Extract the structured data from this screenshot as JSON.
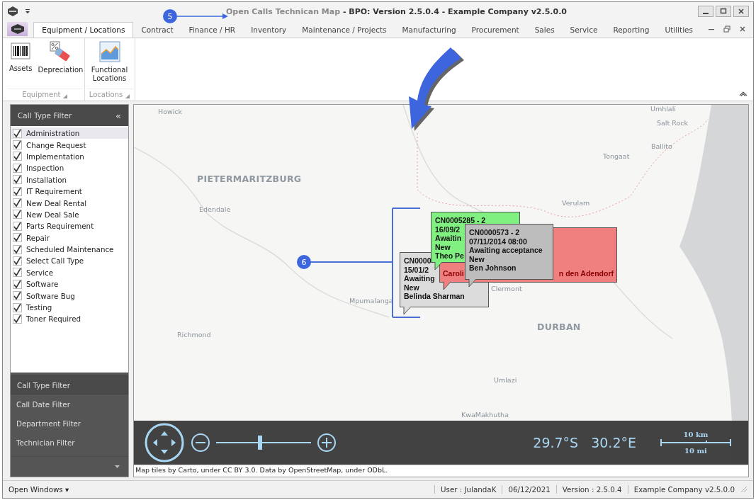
{
  "window": {
    "title_document": "Open Calls Technican Map",
    "title_app": "- BPO: Version 2.5.0.4 - Example Company v2.5.0.0"
  },
  "tabs": [
    {
      "label": "Equipment / Locations",
      "selected": true
    },
    {
      "label": "Contract",
      "selected": false
    },
    {
      "label": "Finance / HR",
      "selected": false
    },
    {
      "label": "Inventory",
      "selected": false
    },
    {
      "label": "Maintenance / Projects",
      "selected": false
    },
    {
      "label": "Manufacturing",
      "selected": false
    },
    {
      "label": "Procurement",
      "selected": false
    },
    {
      "label": "Sales",
      "selected": false
    },
    {
      "label": "Service",
      "selected": false
    },
    {
      "label": "Reporting",
      "selected": false
    },
    {
      "label": "Utilities",
      "selected": false
    }
  ],
  "ribbon": [
    {
      "label": "Equipment",
      "buttons": [
        {
          "kind": "barcode",
          "label": "Assets"
        },
        {
          "kind": "eraser",
          "label": "Depreciation"
        }
      ]
    },
    {
      "label": "Locations",
      "buttons": [
        {
          "kind": "chart",
          "label": "Functional Locations"
        }
      ]
    }
  ],
  "sidebar": {
    "header": "Call Type Filter",
    "collapse": "«",
    "items": [
      {
        "label": "Administration",
        "checked": true,
        "selected": true
      },
      {
        "label": "Change Request",
        "checked": true,
        "selected": false
      },
      {
        "label": "Implementation",
        "checked": true,
        "selected": false
      },
      {
        "label": "Inspection",
        "checked": true,
        "selected": false
      },
      {
        "label": "Installation",
        "checked": true,
        "selected": false
      },
      {
        "label": "IT Requirement",
        "checked": true,
        "selected": false
      },
      {
        "label": "New Deal Rental",
        "checked": true,
        "selected": false
      },
      {
        "label": "New Deal Sale",
        "checked": true,
        "selected": false
      },
      {
        "label": "Parts Requirement",
        "checked": true,
        "selected": false
      },
      {
        "label": "Repair",
        "checked": true,
        "selected": false
      },
      {
        "label": "Scheduled Maintenance",
        "checked": true,
        "selected": false
      },
      {
        "label": "Select Call Type",
        "checked": true,
        "selected": false
      },
      {
        "label": "Service",
        "checked": true,
        "selected": false
      },
      {
        "label": "Software",
        "checked": true,
        "selected": false
      },
      {
        "label": "Software Bug",
        "checked": true,
        "selected": false
      },
      {
        "label": "Testing",
        "checked": true,
        "selected": false
      },
      {
        "label": "Toner Required",
        "checked": true,
        "selected": false
      }
    ],
    "nav": [
      {
        "label": "Call Type Filter",
        "selected": true
      },
      {
        "label": "Call Date Filter",
        "selected": false
      },
      {
        "label": "Department Filter",
        "selected": false
      },
      {
        "label": "Technician Filter",
        "selected": false
      }
    ]
  },
  "map": {
    "places": [
      {
        "label": "Howick",
        "kind": "town"
      },
      {
        "label": "Umhlali",
        "kind": "town"
      },
      {
        "label": "Salt Rock",
        "kind": "town"
      },
      {
        "label": "Ballito",
        "kind": "town"
      },
      {
        "label": "Tongaat",
        "kind": "town"
      },
      {
        "label": "PIETERMARITZBURG",
        "kind": "city"
      },
      {
        "label": "Edendale",
        "kind": "town"
      },
      {
        "label": "Verulam",
        "kind": "town"
      },
      {
        "label": "Mpumalanga",
        "kind": "town"
      },
      {
        "label": "Clermont",
        "kind": "town"
      },
      {
        "label": "DURBAN",
        "kind": "city"
      },
      {
        "label": "Richmond",
        "kind": "town"
      },
      {
        "label": "Umlazi",
        "kind": "town"
      },
      {
        "label": "KwaMakhutha",
        "kind": "town"
      }
    ],
    "callouts": [
      {
        "color": "#80f080",
        "lines": [
          "CN0005285 - 2",
          "16/09/2",
          "Awaitin",
          "New",
          "Theo Pe"
        ]
      },
      {
        "color": "#bdbdbd",
        "lines": [
          "CN0000573 - 2",
          "07/11/2014 08:00",
          "Awaiting acceptance",
          "New",
          "Ben Johnson"
        ]
      },
      {
        "color": "#f08080",
        "lines": [
          "Caroli",
          "n den Adendorf"
        ]
      },
      {
        "color": "#dcdcdc",
        "lines": [
          "CN0000",
          "15/01/2",
          "Awaiting",
          "New",
          "Belinda Sharman"
        ]
      }
    ],
    "zoom": {
      "level": 0.46
    },
    "latitude": "29.7°S",
    "longitude": "30.2°E",
    "scale_km": "10 km",
    "scale_mi": "10 mi",
    "attribution": "Map tiles by Carto, under CC BY 3.0. Data by OpenStreetMap, under ODbL."
  },
  "annotations": [
    {
      "label": "5"
    },
    {
      "label": "6"
    }
  ],
  "status_bar": {
    "open_windows": "Open Windows ▾",
    "items": [
      "User : JulandaK",
      "06/12/2021",
      "Version : 2.5.0.4",
      "Example Company v2.5.0.0"
    ]
  }
}
